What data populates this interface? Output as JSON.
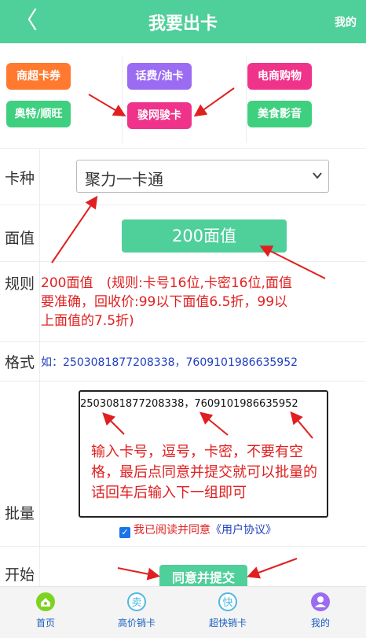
{
  "header": {
    "back_icon": "chevron-left-icon",
    "title": "我要出卡",
    "mine": "我的",
    "bg_color": "#4fcf9a"
  },
  "categories": [
    {
      "label": "商超卡券",
      "color": "#ff7a2f"
    },
    {
      "label": "话费/油卡",
      "color": "#9b6bf2"
    },
    {
      "label": "电商购物",
      "color": "#f0338a"
    },
    {
      "label": "奥特/顺旺",
      "color": "#3fd07f"
    },
    {
      "label": "骏网骏卡",
      "color": "#f0338a"
    },
    {
      "label": "美食影音",
      "color": "#3fd07f"
    }
  ],
  "form": {
    "card_type_label": "卡种",
    "card_type_value": "聚力一卡通",
    "denomination_label": "面值",
    "denomination_value": "200面值",
    "rules_label": "规则",
    "rules_text": "200面值　(规则:卡号16位,卡密16位,面值要准确，回收价:99以下面值6.5折，99以上面值的7.5折)",
    "format_label": "格式",
    "format_text": "如：2503081877208338，7609101986635952",
    "batch_label": "批量",
    "batch_value": "2503081877208338，7609101986635952",
    "batch_note": "输入卡号，逗号，卡密，不要有空格，最后点同意并提交就可以批量的话回车后输入下一组即可",
    "agree_text": "我已阅读并同意",
    "agree_link": "《用户协议》",
    "agree_checked": true,
    "start_label": "开始",
    "submit_label": "同意并提交"
  },
  "tabbar": [
    {
      "label": "首页",
      "icon": "home-icon",
      "color": "#7ed321"
    },
    {
      "label": "高价销卡",
      "icon": "sell-icon",
      "color": "#4fb8e0"
    },
    {
      "label": "超快销卡",
      "icon": "fast-icon",
      "color": "#4fb8e0"
    },
    {
      "label": "我的",
      "icon": "user-icon",
      "color": "#9b6bf2"
    }
  ]
}
